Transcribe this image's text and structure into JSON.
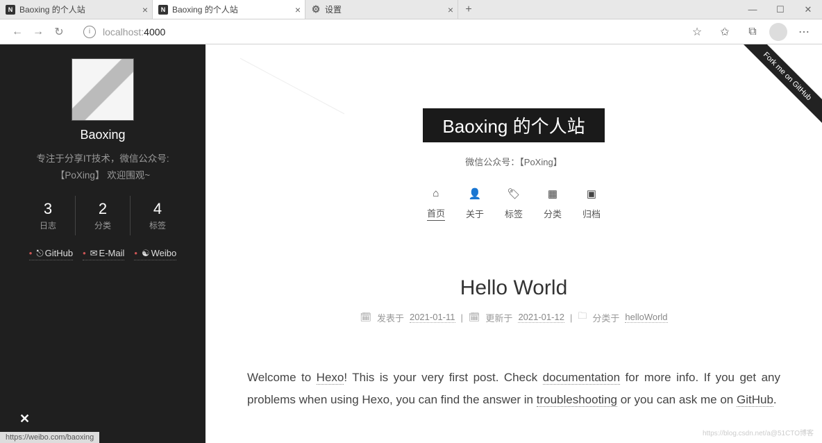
{
  "browser": {
    "tabs": [
      {
        "title": "Baoxing 的个人站",
        "active": false
      },
      {
        "title": "Baoxing 的个人站",
        "active": true
      },
      {
        "title": "设置",
        "active": false,
        "icon": "gear"
      }
    ],
    "url_host": "localhost:",
    "url_port": "4000",
    "status_url": "https://weibo.com/baoxing"
  },
  "sidebar": {
    "author": "Baoxing",
    "description": "专注于分享IT技术，微信公众号:【PoXing】 欢迎围观~",
    "stats": [
      {
        "num": "3",
        "label": "日志"
      },
      {
        "num": "2",
        "label": "分类"
      },
      {
        "num": "4",
        "label": "标签"
      }
    ],
    "social": [
      {
        "icon": "⎋",
        "label": "GitHub"
      },
      {
        "icon": "✉",
        "label": "E-Mail"
      },
      {
        "icon": "☯",
        "label": "Weibo"
      }
    ]
  },
  "header": {
    "title": "Baoxing 的个人站",
    "subtitle": "微信公众号：【PoXing】",
    "fork_label": "Fork me on GitHub"
  },
  "nav": [
    {
      "icon": "⌂",
      "label": "首页",
      "active": true
    },
    {
      "icon": "👤",
      "label": "关于"
    },
    {
      "icon": "🏷",
      "label": "标签"
    },
    {
      "icon": "▦",
      "label": "分类"
    },
    {
      "icon": "▣",
      "label": "归档"
    }
  ],
  "post": {
    "title": "Hello World",
    "posted_prefix": "发表于",
    "posted_date": "2021-01-11",
    "updated_prefix": "更新于",
    "updated_date": "2021-01-12",
    "cat_prefix": "分类于",
    "category": "helloWorld",
    "body_1": "Welcome to ",
    "link_hexo": "Hexo",
    "body_2": "! This is your very first post. Check ",
    "link_doc": "documentation",
    "body_3": " for more info. If you get any problems when using Hexo, you can find the answer in ",
    "link_ts": "troubleshooting",
    "body_4": " or you can ask me on ",
    "link_gh": "GitHub",
    "body_5": "."
  },
  "watermark": "https://blog.csdn.net/a@51CTO博客"
}
